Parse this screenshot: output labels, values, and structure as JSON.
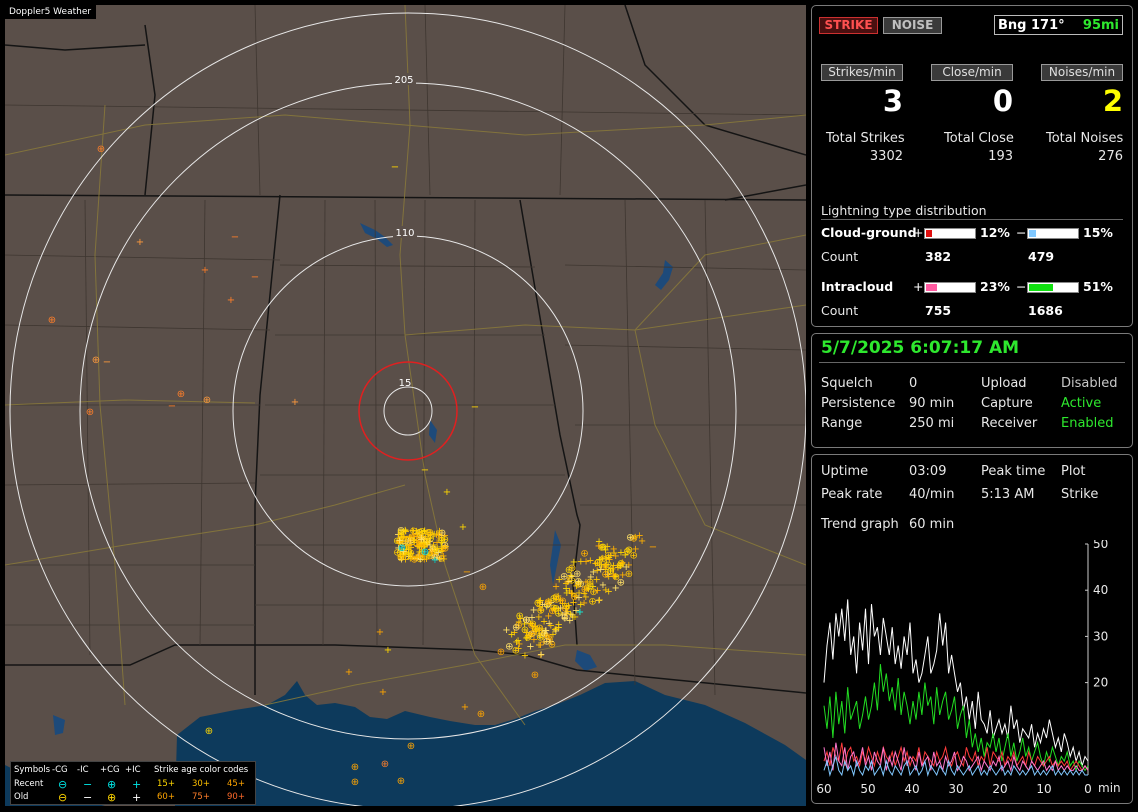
{
  "window_title": "Doppler5 Weather",
  "map": {
    "ring_labels": [
      "205",
      "110",
      "15"
    ]
  },
  "legend": {
    "symbols_label": "Symbols",
    "headers": [
      "-CG",
      "-IC",
      "+CG",
      "+IC"
    ],
    "age_label": "Strike age color codes",
    "recent_label": "Recent",
    "old_label": "Old",
    "recent_symbols": [
      "⊖",
      "−",
      "⊕",
      "+"
    ],
    "old_symbols": [
      "⊖",
      "−",
      "⊕",
      "+"
    ],
    "recent_ages": [
      "15+",
      "30+",
      "45+"
    ],
    "old_ages": [
      "60+",
      "75+",
      "90+"
    ]
  },
  "stats": {
    "strike_button": "STRIKE",
    "noise_button": "NOISE",
    "bearing_label": "Bng 171°",
    "bearing_distance": "95mi",
    "strikes_per_min_label": "Strikes/min",
    "close_per_min_label": "Close/min",
    "noises_per_min_label": "Noises/min",
    "strikes_per_min": "3",
    "close_per_min": "0",
    "noises_per_min": "2",
    "total_strikes_label": "Total Strikes",
    "total_close_label": "Total Close",
    "total_noises_label": "Total Noises",
    "total_strikes": "3302",
    "total_close": "193",
    "total_noises": "276",
    "distribution_title": "Lightning type distribution",
    "cg_label": "Cloud-ground",
    "ic_label": "Intracloud",
    "count_label": "Count",
    "plus_sign": "+",
    "minus_sign": "−",
    "cg_pos_pct": "12%",
    "cg_neg_pct": "15%",
    "ic_pos_pct": "23%",
    "ic_neg_pct": "51%",
    "cg_pos_frac": 0.12,
    "cg_neg_frac": 0.15,
    "ic_pos_frac": 0.23,
    "ic_neg_frac": 0.51,
    "cg_pos_count": "382",
    "cg_neg_count": "479",
    "ic_pos_count": "755",
    "ic_neg_count": "1686",
    "colors": {
      "cg_pos": "#e01010",
      "cg_neg": "#80c8ff",
      "ic_pos": "#ff5aa0",
      "ic_neg": "#10e010"
    }
  },
  "status": {
    "datetime": "5/7/2025 6:07:17 AM",
    "squelch_label": "Squelch",
    "squelch": "0",
    "persistence_label": "Persistence",
    "persistence": "90 min",
    "range_label": "Range",
    "range": "250 mi",
    "upload_label": "Upload",
    "upload": "Disabled",
    "capture_label": "Capture",
    "capture": "Active",
    "receiver_label": "Receiver",
    "receiver": "Enabled"
  },
  "graph": {
    "uptime_label": "Uptime",
    "uptime": "03:09",
    "peak_time_label": "Peak time",
    "peak_time": "5:13 AM",
    "plot_label": "Plot",
    "plot": "Strike",
    "peak_rate_label": "Peak rate",
    "peak_rate": "40/min",
    "trend_label": "Trend graph",
    "trend": "60 min",
    "x_unit": "min"
  },
  "chart_data": {
    "type": "line",
    "x_ticks": [
      60,
      50,
      40,
      30,
      20,
      10,
      0
    ],
    "y_ticks": [
      50,
      40,
      30,
      20
    ],
    "xlim": [
      60,
      0
    ],
    "ylim": [
      0,
      50
    ],
    "series": [
      {
        "color": "#ffffff",
        "values": [
          20,
          28,
          33,
          25,
          35,
          30,
          36,
          29,
          38,
          26,
          30,
          22,
          33,
          27,
          36,
          24,
          37,
          30,
          32,
          26,
          34,
          30,
          26,
          32,
          24,
          28,
          23,
          30,
          26,
          33,
          22,
          25,
          20,
          22,
          26,
          30,
          22,
          24,
          27,
          35,
          28,
          33,
          22,
          26,
          22,
          18,
          20,
          14,
          17,
          12,
          16,
          10,
          18,
          12,
          11,
          9,
          14,
          8,
          10,
          12,
          9,
          11,
          8,
          15,
          10,
          12,
          7,
          10,
          9,
          8,
          11,
          6,
          9,
          7,
          10,
          8,
          12,
          9,
          6,
          8,
          5,
          9,
          7,
          4,
          6,
          3,
          5,
          2,
          4,
          3
        ]
      },
      {
        "color": "#22dd22",
        "values": [
          15,
          10,
          17,
          8,
          18,
          11,
          16,
          9,
          19,
          12,
          14,
          16,
          10,
          13,
          17,
          12,
          15,
          20,
          14,
          24,
          18,
          22,
          16,
          19,
          14,
          21,
          13,
          18,
          15,
          11,
          16,
          12,
          18,
          13,
          20,
          15,
          17,
          11,
          19,
          13,
          16,
          18,
          12,
          14,
          17,
          10,
          13,
          15,
          8,
          12,
          6,
          9,
          5,
          8,
          4,
          7,
          6,
          9,
          5,
          8,
          3,
          6,
          9,
          4,
          7,
          3,
          5,
          8,
          4,
          6,
          3,
          5,
          7,
          4,
          2,
          5,
          3,
          6,
          4,
          2,
          4,
          3,
          5,
          2,
          3,
          1,
          3,
          2,
          1,
          2
        ]
      },
      {
        "color": "#ff3b3b",
        "values": [
          3,
          5,
          2,
          6,
          4,
          3,
          7,
          2,
          5,
          6,
          3,
          4,
          2,
          5,
          3,
          6,
          4,
          2,
          5,
          3,
          6,
          4,
          3,
          5,
          2,
          4,
          6,
          3,
          5,
          2,
          4,
          3,
          6,
          2,
          5,
          4,
          3,
          2,
          5,
          3,
          4,
          6,
          3,
          2,
          4,
          5,
          3,
          2,
          6,
          4,
          3,
          5,
          2,
          4,
          3,
          6,
          2,
          5,
          4,
          3,
          5,
          2,
          4,
          3,
          5,
          2,
          3,
          4,
          2,
          5,
          3,
          2,
          4,
          3,
          2,
          3,
          4,
          2,
          3,
          2,
          3,
          2,
          3,
          1,
          2,
          3,
          2,
          1,
          2,
          1
        ]
      },
      {
        "color": "#ff77cc",
        "values": [
          6,
          2,
          5,
          1,
          7,
          3,
          2,
          6,
          1,
          4,
          5,
          2,
          3,
          6,
          2,
          4,
          1,
          5,
          3,
          2,
          6,
          1,
          4,
          2,
          5,
          3,
          1,
          6,
          2,
          4,
          3,
          1,
          5,
          2,
          3,
          4,
          1,
          5,
          2,
          3,
          1,
          4,
          2,
          3,
          5,
          1,
          2,
          4,
          3,
          1,
          2,
          3,
          4,
          1,
          3,
          2,
          1,
          3,
          2,
          4,
          1,
          2,
          3,
          1,
          4,
          2,
          1,
          3,
          2,
          1,
          3,
          2,
          1,
          2,
          3,
          1,
          2,
          1,
          3,
          1,
          2,
          1,
          2,
          1,
          1,
          2,
          1,
          1,
          2,
          1
        ]
      },
      {
        "color": "#80c8ff",
        "values": [
          1,
          3,
          0,
          2,
          4,
          1,
          0,
          3,
          1,
          2,
          0,
          3,
          1,
          0,
          2,
          1,
          3,
          0,
          1,
          2,
          0,
          3,
          1,
          0,
          2,
          1,
          0,
          2,
          3,
          0,
          1,
          2,
          0,
          1,
          3,
          0,
          2,
          1,
          0,
          2,
          1,
          0,
          3,
          1,
          0,
          2,
          1,
          0,
          1,
          2,
          0,
          1,
          2,
          0,
          1,
          0,
          2,
          1,
          0,
          1,
          2,
          0,
          1,
          0,
          2,
          1,
          0,
          1,
          0,
          1,
          2,
          0,
          1,
          0,
          1,
          0,
          1,
          2,
          0,
          1,
          0,
          1,
          0,
          1,
          0,
          1,
          0,
          1,
          0,
          0
        ]
      }
    ]
  }
}
